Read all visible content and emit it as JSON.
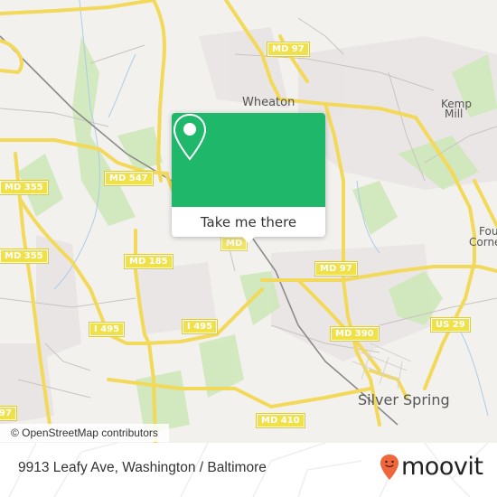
{
  "map": {
    "shields": [
      {
        "label": "MD 97"
      },
      {
        "label": "MD 547"
      },
      {
        "label": "MD 355"
      },
      {
        "label": "MD 355"
      },
      {
        "label": "MD 185"
      },
      {
        "label": "MD 97"
      },
      {
        "label": "I 495"
      },
      {
        "label": "I 495"
      },
      {
        "label": "US 29"
      },
      {
        "label": "MD 390"
      },
      {
        "label": "MD 410"
      },
      {
        "label": "MD"
      },
      {
        "label": "97"
      }
    ],
    "places": [
      {
        "label": "Wheaton"
      },
      {
        "label": "Kemp"
      },
      {
        "label": "Mill"
      },
      {
        "label": "Four"
      },
      {
        "label": "Corners"
      },
      {
        "label": "Silver Spring"
      }
    ],
    "attribution": "© OpenStreetMap contributors",
    "marker_icon": "map-pin-icon"
  },
  "popup": {
    "button_label": "Take me there",
    "accent_color": "#1fb76a"
  },
  "footer": {
    "address": "9913 Leafy Ave, Washington / Baltimore",
    "brand": "moovit",
    "brand_icon": "moovit-logo-icon",
    "brand_color": "#f0653a"
  }
}
